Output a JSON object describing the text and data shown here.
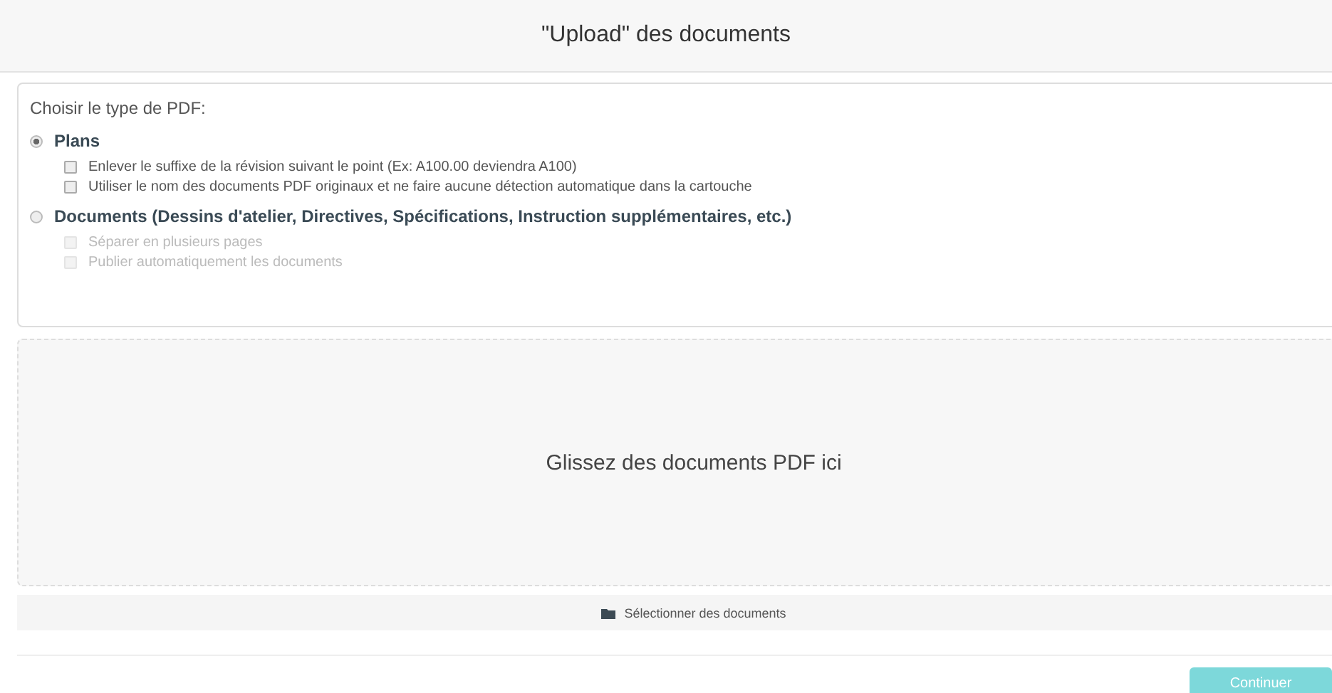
{
  "header": {
    "title": "\"Upload\" des documents"
  },
  "pdf_type": {
    "label": "Choisir le type de PDF:",
    "options": [
      {
        "label": "Plans",
        "selected": true,
        "checkboxes": [
          {
            "label": "Enlever le suffixe de la révision suivant le point (Ex: A100.00 deviendra A100)",
            "checked": false,
            "disabled": false
          },
          {
            "label": "Utiliser le nom des documents PDF originaux et ne faire aucune détection automatique dans la cartouche",
            "checked": false,
            "disabled": false
          }
        ]
      },
      {
        "label": "Documents (Dessins d'atelier, Directives, Spécifications, Instruction supplémentaires, etc.)",
        "selected": false,
        "checkboxes": [
          {
            "label": "Séparer en plusieurs pages",
            "checked": false,
            "disabled": true
          },
          {
            "label": "Publier automatiquement les documents",
            "checked": false,
            "disabled": true
          }
        ]
      }
    ]
  },
  "dropzone": {
    "text": "Glissez des documents PDF ici"
  },
  "select_button": {
    "label": "Sélectionner des documents"
  },
  "continue_button": {
    "label": "Continuer",
    "disabled": true
  }
}
